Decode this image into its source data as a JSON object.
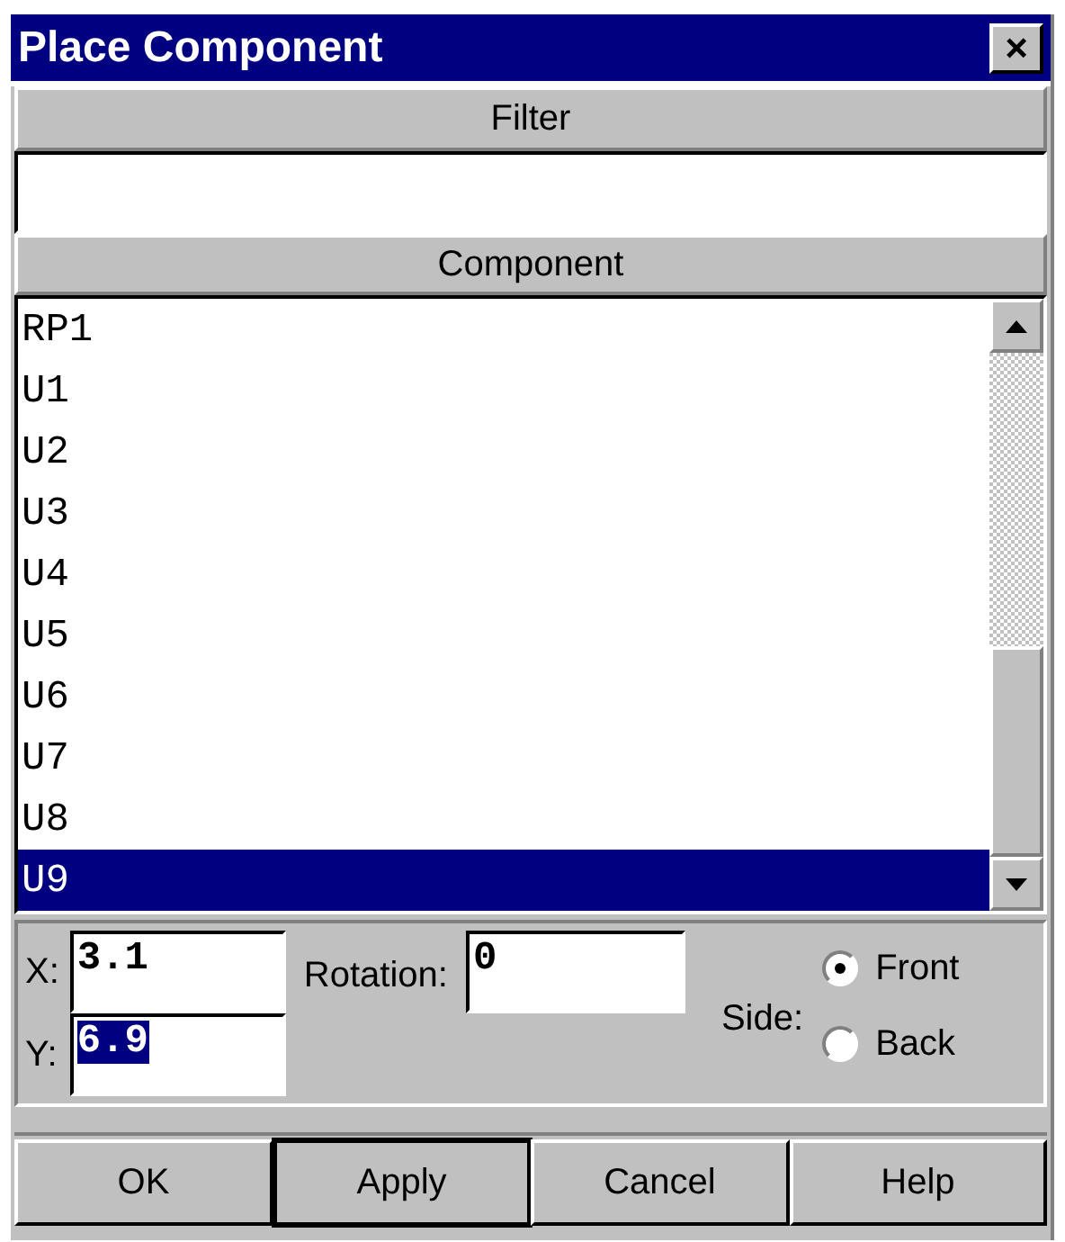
{
  "window": {
    "title": "Place Component",
    "close": "×"
  },
  "filter": {
    "header": "Filter"
  },
  "component": {
    "header": "Component",
    "items": [
      {
        "label": "RP1",
        "selected": false
      },
      {
        "label": "U1",
        "selected": false
      },
      {
        "label": "U2",
        "selected": false
      },
      {
        "label": "U3",
        "selected": false
      },
      {
        "label": "U4",
        "selected": false
      },
      {
        "label": "U5",
        "selected": false
      },
      {
        "label": "U6",
        "selected": false
      },
      {
        "label": "U7",
        "selected": false
      },
      {
        "label": "U8",
        "selected": false
      },
      {
        "label": "U9",
        "selected": true
      }
    ]
  },
  "x": {
    "label": "X:",
    "value": "3.1",
    "highlighted": false
  },
  "y": {
    "label": "Y:",
    "value": "6.9",
    "highlighted": true
  },
  "rotation": {
    "label": "Rotation:",
    "value": "0"
  },
  "side": {
    "label": "Side:",
    "options": [
      {
        "label": "Front",
        "selected": true
      },
      {
        "label": "Back",
        "selected": false
      }
    ]
  },
  "buttons": [
    {
      "label": "OK",
      "default": false
    },
    {
      "label": "Apply",
      "default": true
    },
    {
      "label": "Cancel",
      "default": false
    },
    {
      "label": "Help",
      "default": false
    }
  ]
}
